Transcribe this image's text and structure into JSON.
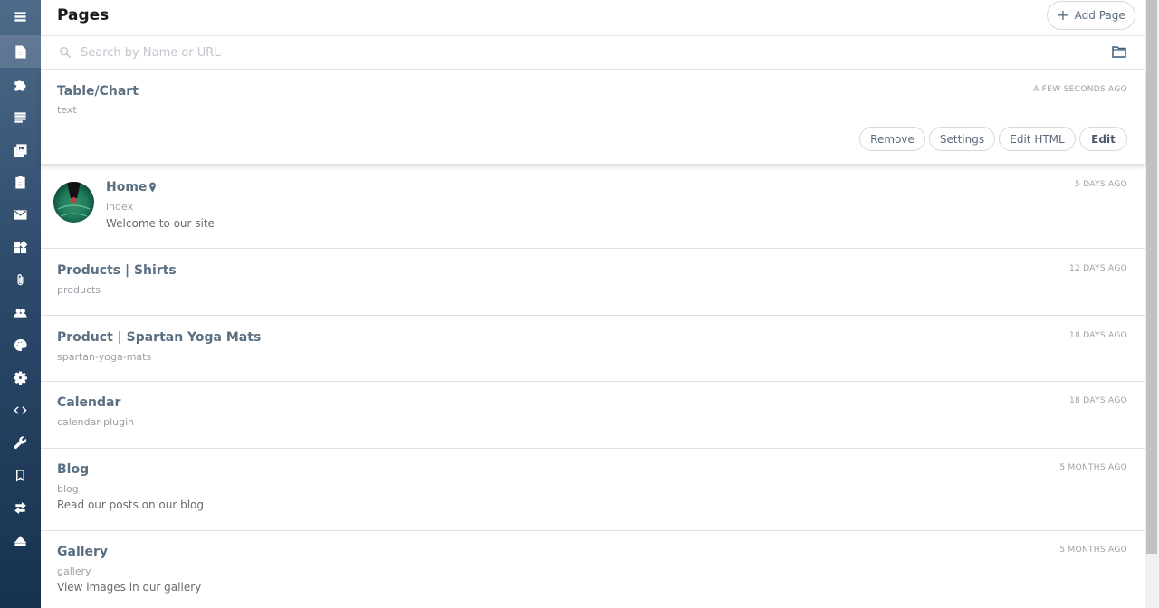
{
  "sidebar": {
    "items": [
      {
        "icon": "menu-icon"
      },
      {
        "icon": "page-icon"
      },
      {
        "icon": "puzzle-icon"
      },
      {
        "icon": "lines-icon"
      },
      {
        "icon": "image-icon"
      },
      {
        "icon": "clipboard-icon"
      },
      {
        "icon": "mail-icon"
      },
      {
        "icon": "widgets-icon"
      },
      {
        "icon": "paperclip-icon"
      },
      {
        "icon": "users-icon"
      },
      {
        "icon": "palette-icon"
      },
      {
        "icon": "gear-icon"
      },
      {
        "icon": "code-icon"
      },
      {
        "icon": "wrench-icon"
      },
      {
        "icon": "bookmark-icon"
      },
      {
        "icon": "transfer-icon"
      },
      {
        "icon": "eject-icon"
      }
    ],
    "active_index": 1
  },
  "header": {
    "title": "Pages",
    "add_page_label": "Add Page"
  },
  "search": {
    "placeholder": "Search by Name or URL",
    "value": ""
  },
  "pages": [
    {
      "title": "Table/Chart",
      "url": "text",
      "description": "",
      "time": "A FEW SECONDS AGO",
      "expanded": true,
      "actions": {
        "remove": "Remove",
        "settings": "Settings",
        "edit_html": "Edit HTML",
        "edit": "Edit"
      }
    },
    {
      "title": "Home",
      "url": "index",
      "description": "Welcome to our site",
      "time": "5 DAYS AGO",
      "is_home": true
    },
    {
      "title": "Products | Shirts",
      "url": "products",
      "description": "",
      "time": "12 DAYS AGO"
    },
    {
      "title": "Product | Spartan Yoga Mats",
      "url": "spartan-yoga-mats",
      "description": "",
      "time": "18 DAYS AGO"
    },
    {
      "title": "Calendar",
      "url": "calendar-plugin",
      "description": "",
      "time": "18 DAYS AGO"
    },
    {
      "title": "Blog",
      "url": "blog",
      "description": "Read our posts on our blog",
      "time": "5 MONTHS AGO"
    },
    {
      "title": "Gallery",
      "url": "gallery",
      "description": "View images in our gallery",
      "time": "5 MONTHS AGO"
    }
  ]
}
